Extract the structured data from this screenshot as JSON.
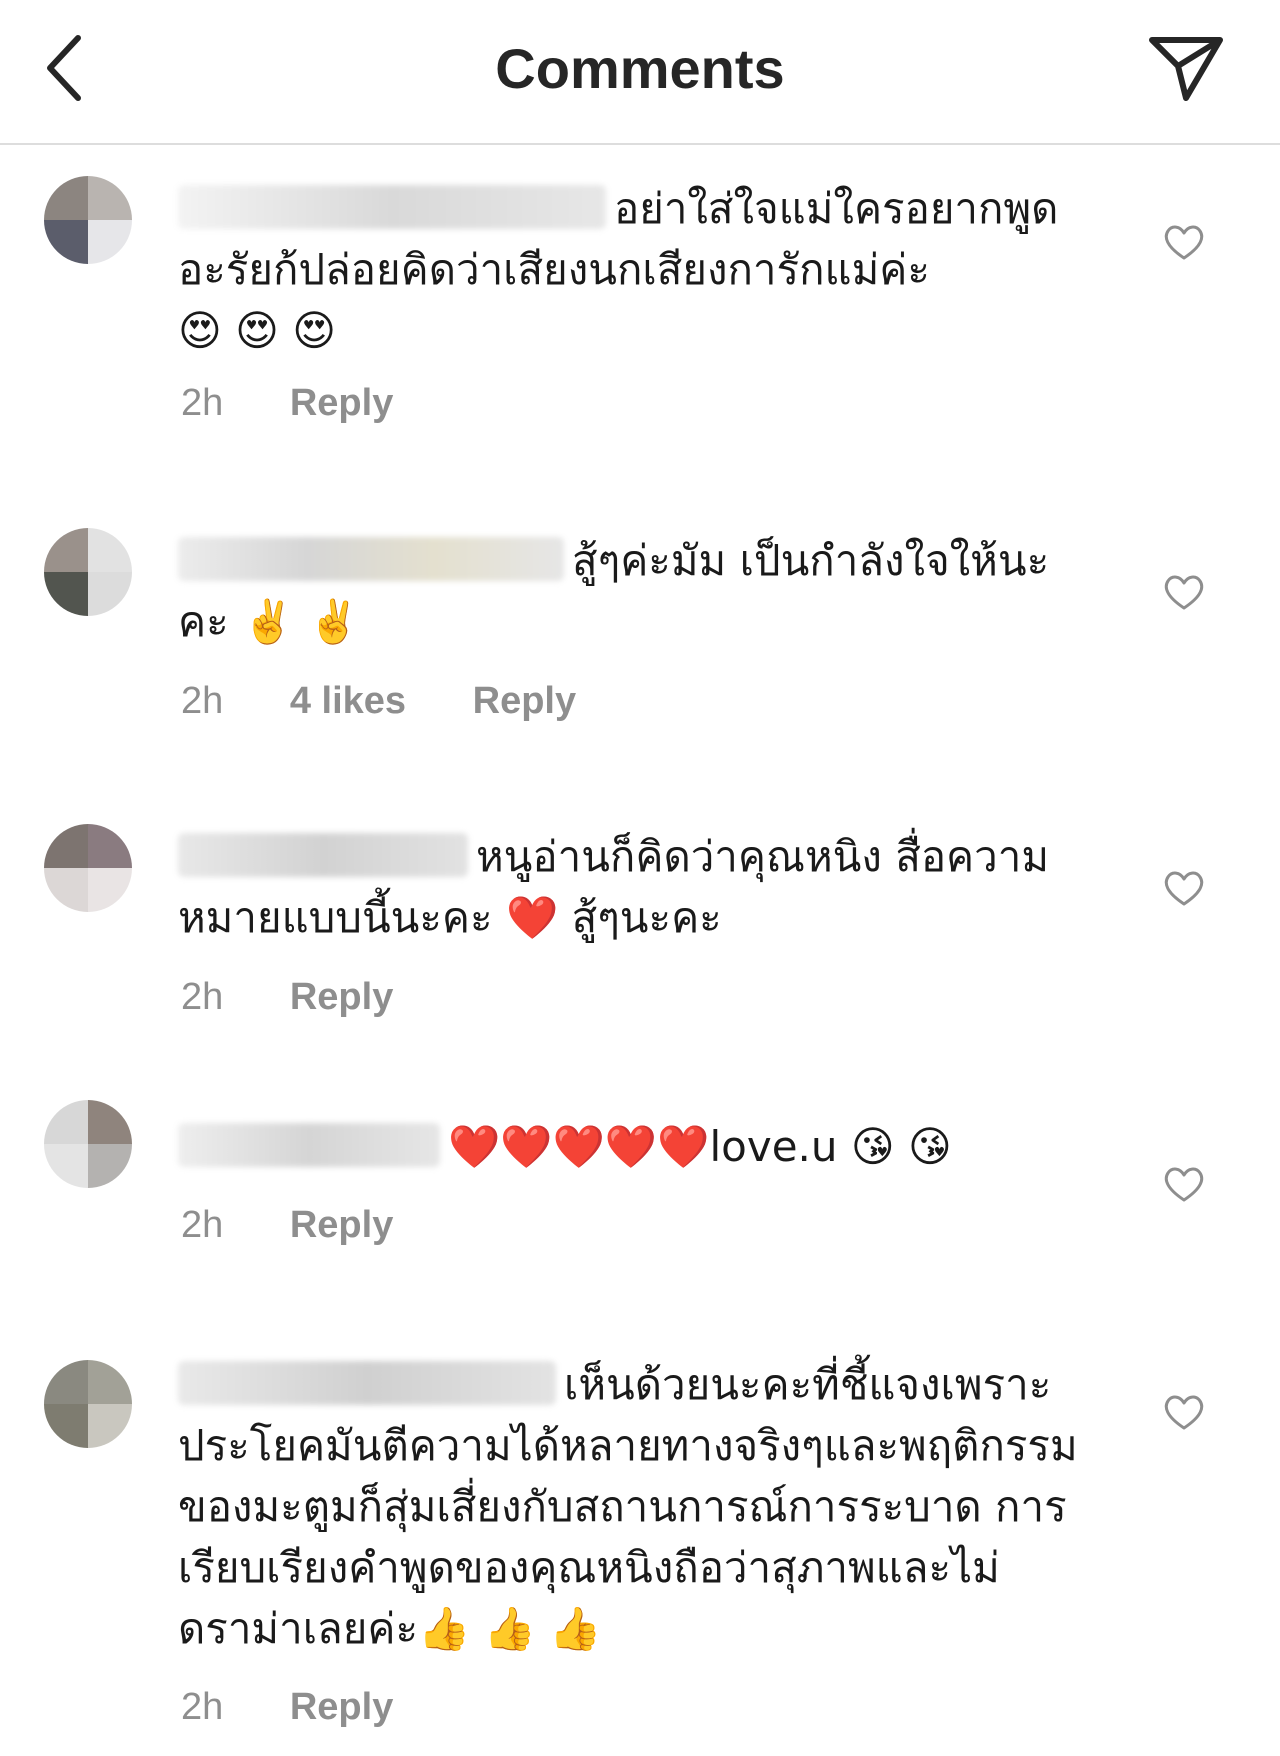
{
  "header": {
    "title": "Comments",
    "back_icon": "chevron-left-icon",
    "share_icon": "paper-plane-icon"
  },
  "comments": [
    {
      "text": "อย่าใส่ใจแม่ใครอยากพูดอะรัยก้ปล่อยคิดว่าเสียงนกเสียงการักแม่ค่ะ",
      "emoji": "😍 😍 😍",
      "time": "2h",
      "reply": "Reply",
      "likes": null
    },
    {
      "text": "สู้ๆค่ะมัม เป็นกำลังใจให้นะคะ",
      "emoji": "✌️ ✌️",
      "time": "2h",
      "likes": "4 likes",
      "reply": "Reply"
    },
    {
      "text": "หนูอ่านก็คิดว่าคุณหนิง สื่อความหมายแบบนี้นะคะ",
      "emoji": "❤️",
      "text_after": "สู้ๆนะคะ",
      "time": "2h",
      "reply": "Reply",
      "likes": null
    },
    {
      "emoji_before": "❤️❤️❤️❤️❤️",
      "text": "love.u",
      "emoji": "😘 😘",
      "time": "2h",
      "reply": "Reply",
      "likes": null
    },
    {
      "text": "เห็นด้วยนะคะที่ชี้แจงเพราะประโยคมันตีความได้หลายทางจริงๆและพฤติกรรมของมะตูมก็สุ่มเสี่ยงกับสถานการณ์การระบาด การเรียบเรียงคำพูดของคุณหนิงถือว่าสุภาพและไม่ดราม่าเลยค่ะ",
      "emoji": "👍 👍 👍",
      "time": "2h",
      "reply": "Reply",
      "likes": null
    }
  ],
  "colors": {
    "meta_text": "#8e8e8e",
    "heart_outline": "#8e8e8e",
    "divider": "#dddddd"
  }
}
